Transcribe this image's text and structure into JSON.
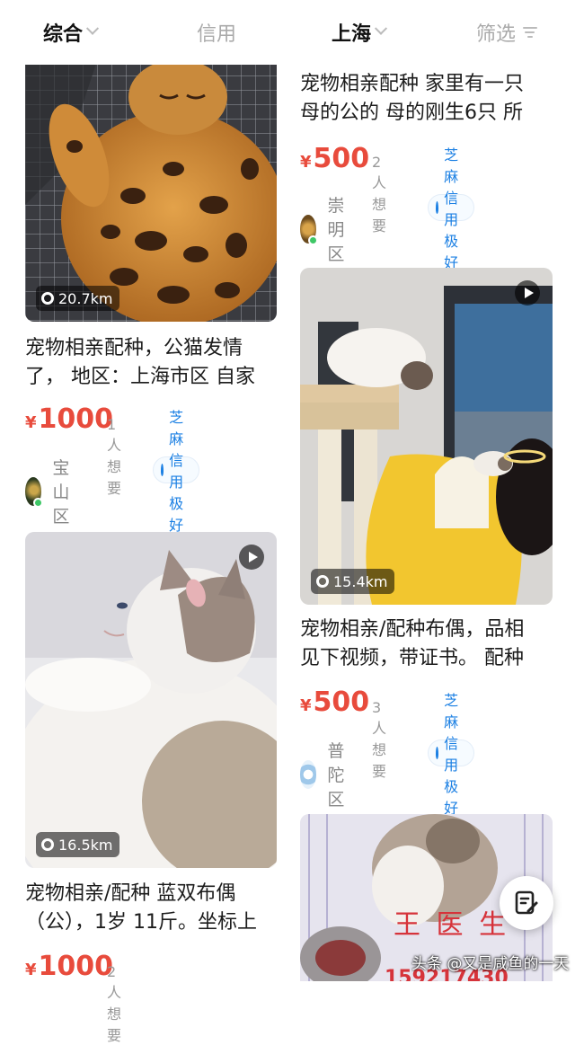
{
  "tabs": {
    "overall": "综合",
    "credit": "信用",
    "city": "上海",
    "filter": "筛选"
  },
  "cards": [
    {
      "distance": "20.7km",
      "title": "宠物相亲配种，公猫发情\n了， 地区：上海市区 自家",
      "currency": "¥",
      "price": "1000",
      "want": "1人想要",
      "district": "宝山区",
      "badge": "芝麻信用极好"
    },
    {
      "distance": "16.5km",
      "title": "宠物相亲/配种 蓝双布偶\n（公），1岁 11斤。坐标上",
      "currency": "¥",
      "price": "1000",
      "want": "2人想要"
    },
    {
      "title": "宠物相亲配种 家里有一只\n母的公的 母的刚生6只 所",
      "currency": "¥",
      "price": "500",
      "want": "2人想要",
      "district": "崇明区",
      "badge": "芝麻信用极好"
    },
    {
      "distance": "15.4km",
      "title": "宠物相亲/配种布偶，品相\n见下视频，带证书。 配种",
      "currency": "¥",
      "price": "500",
      "want": "3人想要",
      "district": "普陀区",
      "badge": "芝麻信用极好"
    },
    {
      "image_text": "王 医 生",
      "image_number": "159217430"
    }
  ],
  "watermark": "头条 @又是咸鱼的一天",
  "icons": {
    "location": "location-pin-icon",
    "play": "play-icon",
    "credit": "water-drop-icon",
    "publish": "edit-note-icon"
  },
  "colors": {
    "price": "#e84b3c",
    "badge": "#1a7fe3",
    "online": "#3ec766"
  }
}
